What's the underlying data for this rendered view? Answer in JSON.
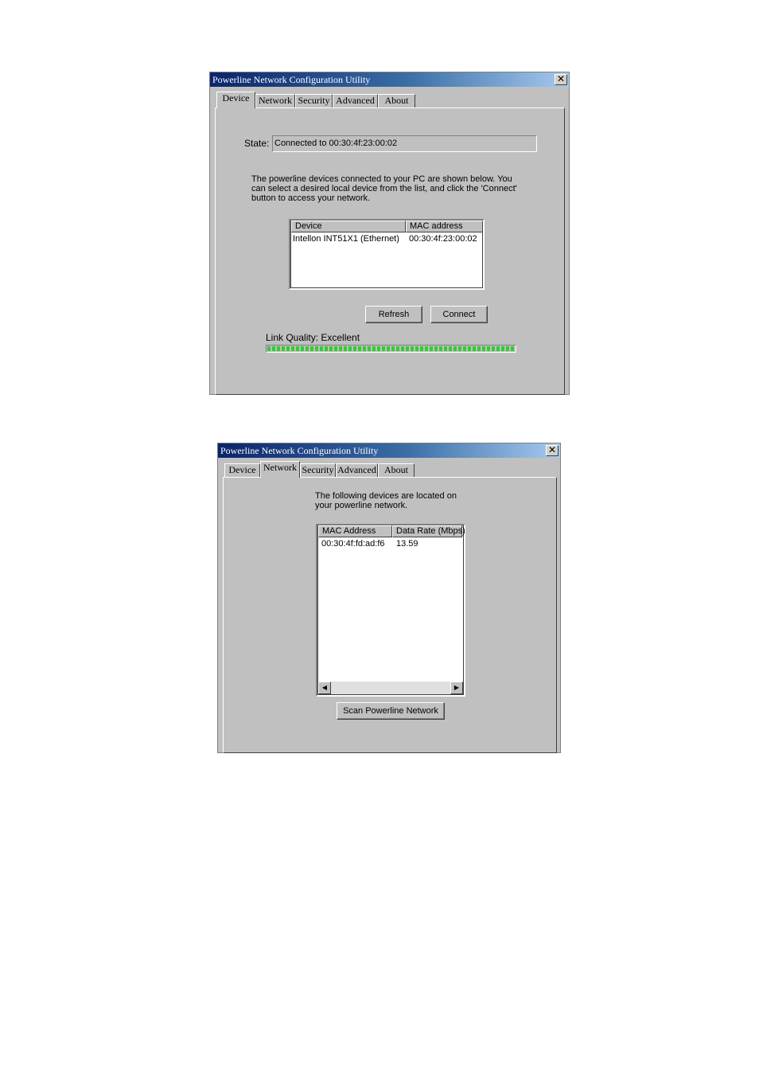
{
  "window1": {
    "title": "Powerline Network Configuration Utility",
    "close_glyph": "✕",
    "tabs": [
      {
        "label": "Device",
        "active": true
      },
      {
        "label": "Network",
        "active": false
      },
      {
        "label": "Security",
        "active": false
      },
      {
        "label": "Advanced",
        "active": false
      },
      {
        "label": "About",
        "active": false
      }
    ],
    "state_label": "State:",
    "state_value": "Connected to 00:30:4f:23:00:02",
    "description": "The powerline devices connected to your PC are shown below.  You can select a desired local device from the list, and click the 'Connect' button to access your network.",
    "list": {
      "columns": [
        "Device",
        "MAC address"
      ],
      "rows": [
        [
          "Intellon INT51X1 (Ethernet)",
          "00:30:4f:23:00:02"
        ]
      ]
    },
    "refresh_label": "Refresh",
    "connect_label": "Connect",
    "link_quality_label": "Link Quality: Excellent",
    "link_quality_fraction": 1.0,
    "link_quality_color": "#33cc33"
  },
  "window2": {
    "title": "Powerline Network Configuration Utility",
    "close_glyph": "✕",
    "tabs": [
      {
        "label": "Device",
        "active": false
      },
      {
        "label": "Network",
        "active": true
      },
      {
        "label": "Security",
        "active": false
      },
      {
        "label": "Advanced",
        "active": false
      },
      {
        "label": "About",
        "active": false
      }
    ],
    "description": "The following devices are located on your powerline network.",
    "list": {
      "columns": [
        "MAC Address",
        "Data Rate (Mbps)"
      ],
      "rows": [
        [
          "00:30:4f:fd:ad:f6",
          "13.59"
        ]
      ]
    },
    "scroll_left_glyph": "◀",
    "scroll_right_glyph": "▶",
    "scan_label": "Scan Powerline Network"
  },
  "colors": {
    "titlebar_start": "#0a246a",
    "titlebar_end": "#a6caf0",
    "face": "#c0c0c0"
  }
}
